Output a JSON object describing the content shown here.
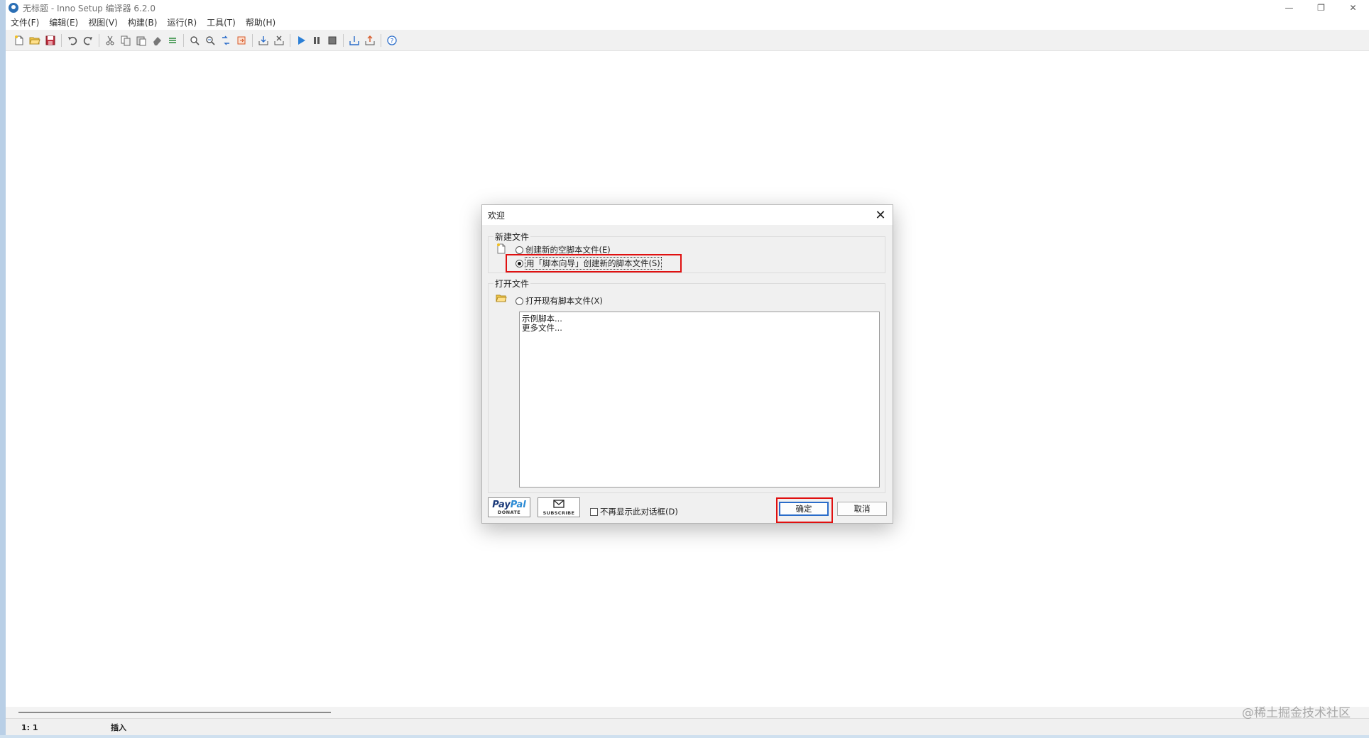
{
  "window": {
    "title": "无标题 - Inno Setup 编译器 6.2.0",
    "minimize_glyph": "—",
    "restore_glyph": "❐",
    "close_glyph": "✕"
  },
  "menu": [
    "文件(F)",
    "编辑(E)",
    "视图(V)",
    "构建(B)",
    "运行(R)",
    "工具(T)",
    "帮助(H)"
  ],
  "status": {
    "position": "1:   1",
    "mode": "插入"
  },
  "watermark": "@稀土掘金技术社区",
  "dialog": {
    "title": "欢迎",
    "close_glyph": "✕",
    "new_group_label": "新建文件",
    "option_empty": "创建新的空脚本文件(E)",
    "option_wizard": "用「脚本向导」创建新的脚本文件(S)",
    "open_group_label": "打开文件",
    "option_open": "打开现有脚本文件(X)",
    "list_items": [
      "示例脚本...",
      "更多文件..."
    ],
    "donate_logo_a": "Pay",
    "donate_logo_b": "Pal",
    "donate_caption": "DONATE",
    "subscribe_caption": "SUBSCRIBE",
    "dont_show": "不再显示此对话框(D)",
    "ok": "确定",
    "cancel": "取消",
    "selected_option": "wizard"
  },
  "colors": {
    "highlight": "#e01010",
    "accent": "#2a6cc9",
    "run_icon": "#2b7fd6"
  },
  "toolbar_icons": [
    "new-file-icon",
    "open-file-icon",
    "save-icon",
    "undo-icon",
    "redo-icon",
    "cut-icon",
    "copy-icon",
    "paste-icon",
    "clear-icon",
    "select-all-icon",
    "find-icon",
    "find-next-icon",
    "replace-icon",
    "goto-icon",
    "compile-icon",
    "stop-compile-icon",
    "run-icon",
    "pause-icon",
    "stop-icon",
    "target-icon",
    "export-icon",
    "help-icon"
  ]
}
